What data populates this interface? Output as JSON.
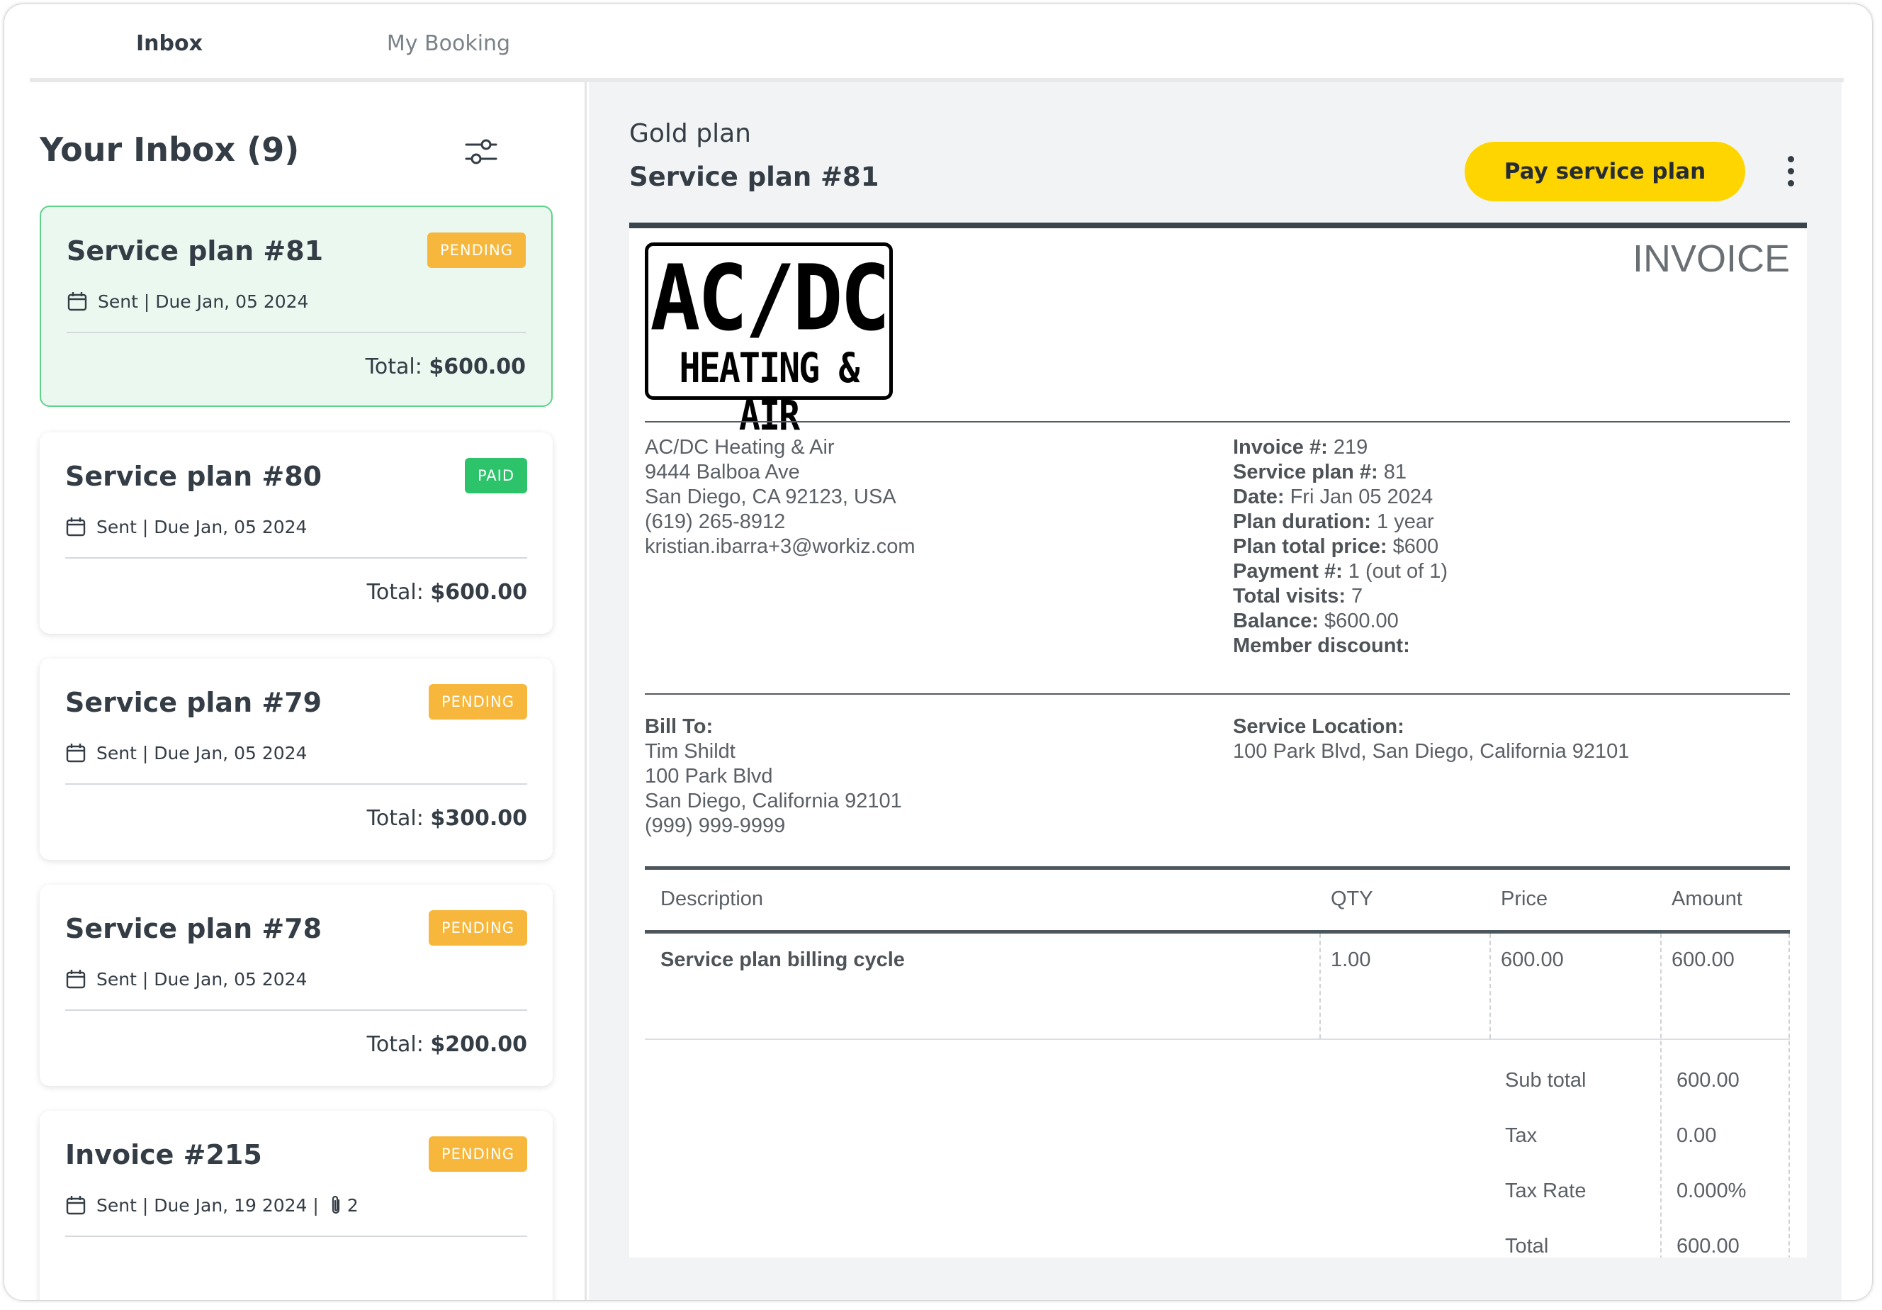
{
  "tabs": [
    {
      "label": "Inbox",
      "active": true
    },
    {
      "label": "My Booking",
      "active": false
    }
  ],
  "inbox": {
    "title": "Your Inbox (9)",
    "cards": [
      {
        "title": "Service plan #81",
        "status": "PENDING",
        "meta": "Sent | Due Jan, 05 2024",
        "total_label": "Total:",
        "total": "$600.00",
        "attachments": ""
      },
      {
        "title": "Service plan #80",
        "status": "PAID",
        "meta": "Sent | Due Jan, 05 2024",
        "total_label": "Total:",
        "total": "$600.00",
        "attachments": ""
      },
      {
        "title": "Service plan #79",
        "status": "PENDING",
        "meta": "Sent | Due Jan, 05 2024",
        "total_label": "Total:",
        "total": "$300.00",
        "attachments": ""
      },
      {
        "title": "Service plan #78",
        "status": "PENDING",
        "meta": "Sent | Due Jan, 05 2024",
        "total_label": "Total:",
        "total": "$200.00",
        "attachments": ""
      },
      {
        "title": "Invoice #215",
        "status": "PENDING",
        "meta": "Sent | Due Jan, 19 2024 |",
        "total_label": "",
        "total": "",
        "attachments": "2"
      }
    ]
  },
  "detail": {
    "plan_name": "Gold plan",
    "title": "Service plan #81",
    "pay_button": "Pay service plan"
  },
  "invoice": {
    "heading": "INVOICE",
    "logo": {
      "line1": "AC/DC",
      "line2": "HEATING & AIR"
    },
    "company": {
      "name": "AC/DC Heating & Air",
      "street": "9444 Balboa Ave",
      "city": "San Diego, CA 92123, USA",
      "phone": "(619) 265-8912",
      "email": "kristian.ibarra+3@workiz.com"
    },
    "meta": [
      {
        "key": "Invoice #:",
        "value": " 219"
      },
      {
        "key": "Service plan #:",
        "value": " 81"
      },
      {
        "key": "Date:",
        "value": " Fri Jan 05 2024"
      },
      {
        "key": "Plan duration:",
        "value": " 1 year"
      },
      {
        "key": "Plan total price:",
        "value": " $600"
      },
      {
        "key": "Payment #:",
        "value": " 1 (out of 1)"
      },
      {
        "key": "Total visits:",
        "value": " 7"
      },
      {
        "key": "Balance:",
        "value": " $600.00"
      },
      {
        "key": "Member discount:",
        "value": ""
      }
    ],
    "bill_to": {
      "label": "Bill To:",
      "name": "Tim Shildt",
      "street": "100 Park Blvd",
      "city": "San Diego, California 92101",
      "phone": "(999) 999-9999"
    },
    "service_location": {
      "label": "Service Location:",
      "address": "100 Park Blvd, San Diego, California 92101"
    },
    "table": {
      "headers": {
        "description": "Description",
        "qty": "QTY",
        "price": "Price",
        "amount": "Amount"
      },
      "rows": [
        {
          "description": "Service plan billing cycle",
          "qty": "1.00",
          "price": "600.00",
          "amount": "600.00"
        }
      ],
      "summary": [
        {
          "label": "Sub total",
          "value": "600.00"
        },
        {
          "label": "Tax",
          "value": "0.00"
        },
        {
          "label": "Tax Rate",
          "value": "0.000%"
        },
        {
          "label": "Total",
          "value": "600.00"
        }
      ]
    }
  },
  "colors": {
    "accent_green": "#3ec26b",
    "pending": "#f6b73c",
    "paid": "#2cc36b",
    "pay_button": "#ffd500",
    "selected_card_bg": "#eaf8f0"
  },
  "icons": [
    "filter-sliders-icon",
    "calendar-icon",
    "paperclip-icon",
    "more-vertical-icon"
  ]
}
